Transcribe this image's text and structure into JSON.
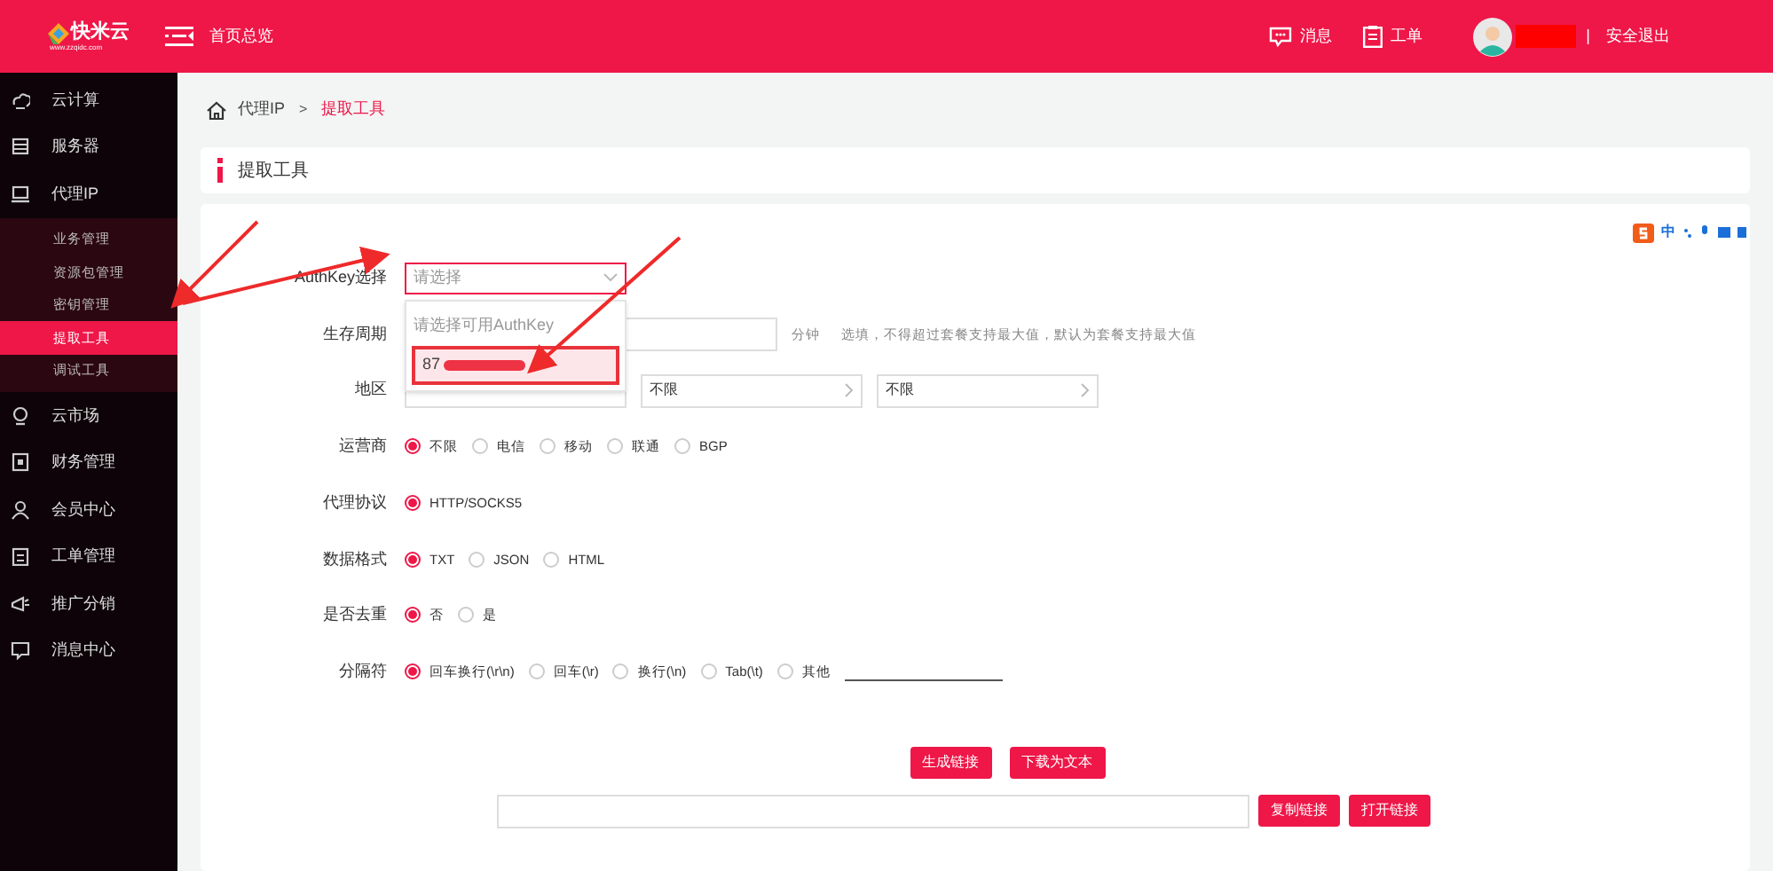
{
  "header": {
    "logo": "快米云",
    "logo_url": "www.zzqidc.com",
    "nav": "首页总览",
    "messages": "消息",
    "tickets": "工单",
    "divider": "|",
    "logout": "安全退出"
  },
  "sidebar": {
    "items": [
      {
        "label": "云计算",
        "selected": false
      },
      {
        "label": "服务器",
        "selected": false
      },
      {
        "label": "代理IP",
        "selected": false,
        "children": [
          {
            "label": "业务管理",
            "selected": false
          },
          {
            "label": "资源包管理",
            "selected": false
          },
          {
            "label": "密钥管理",
            "selected": false
          },
          {
            "label": "提取工具",
            "selected": true
          },
          {
            "label": "调试工具",
            "selected": false
          }
        ]
      },
      {
        "label": "云市场",
        "selected": false
      },
      {
        "label": "财务管理",
        "selected": false
      },
      {
        "label": "会员中心",
        "selected": false
      },
      {
        "label": "工单管理",
        "selected": false
      },
      {
        "label": "推广分销",
        "selected": false
      },
      {
        "label": "消息中心",
        "selected": false
      }
    ]
  },
  "breadcrumb": {
    "items": [
      "代理IP",
      "提取工具"
    ],
    "separator": ">"
  },
  "page_title": "提取工具",
  "ime_toolbar": {
    "label": "中"
  },
  "form": {
    "rows": [
      {
        "kind": "select",
        "label": "AuthKey选择",
        "placeholder": "请选择",
        "options": [
          {
            "label": "请选择可用AuthKey",
            "selected": false
          },
          {
            "label": "87",
            "selected": true
          }
        ]
      },
      {
        "kind": "input",
        "label": "生存周期",
        "unit": "分钟",
        "hint": "选填，不得超过套餐支持最大值，默认为套餐支持最大值"
      },
      {
        "kind": "region",
        "label": "地区",
        "selects": [
          {
            "value": "不限"
          },
          {
            "value": "不限"
          }
        ]
      },
      {
        "kind": "radio",
        "label": "运营商",
        "options": [
          {
            "label": "不限",
            "selected": true
          },
          {
            "label": "电信",
            "selected": false
          },
          {
            "label": "移动",
            "selected": false
          },
          {
            "label": "联通",
            "selected": false
          },
          {
            "label": "BGP",
            "selected": false
          }
        ]
      },
      {
        "kind": "radio",
        "label": "代理协议",
        "options": [
          {
            "label": "HTTP/SOCKS5",
            "selected": true
          }
        ]
      },
      {
        "kind": "radio",
        "label": "数据格式",
        "options": [
          {
            "label": "TXT",
            "selected": true
          },
          {
            "label": "JSON",
            "selected": false
          },
          {
            "label": "HTML",
            "selected": false
          }
        ]
      },
      {
        "kind": "radio",
        "label": "是否去重",
        "options": [
          {
            "label": "否",
            "selected": true
          },
          {
            "label": "是",
            "selected": false
          }
        ]
      },
      {
        "kind": "radio",
        "label": "分隔符",
        "options": [
          {
            "kind": "plain",
            "label": "回车换行(\\r\\n)",
            "selected": true
          },
          {
            "kind": "plain",
            "label": "回车(\\r)",
            "selected": false
          },
          {
            "kind": "plain",
            "label": "换行(\\n)",
            "selected": false
          },
          {
            "kind": "plain",
            "label": "Tab(\\t)",
            "selected": false
          },
          {
            "kind": "with_field",
            "label": "其他",
            "selected": false
          }
        ]
      }
    ],
    "actions": [
      "生成链接",
      "下载为文本"
    ],
    "link_actions": [
      "复制链接",
      "打开链接"
    ]
  }
}
